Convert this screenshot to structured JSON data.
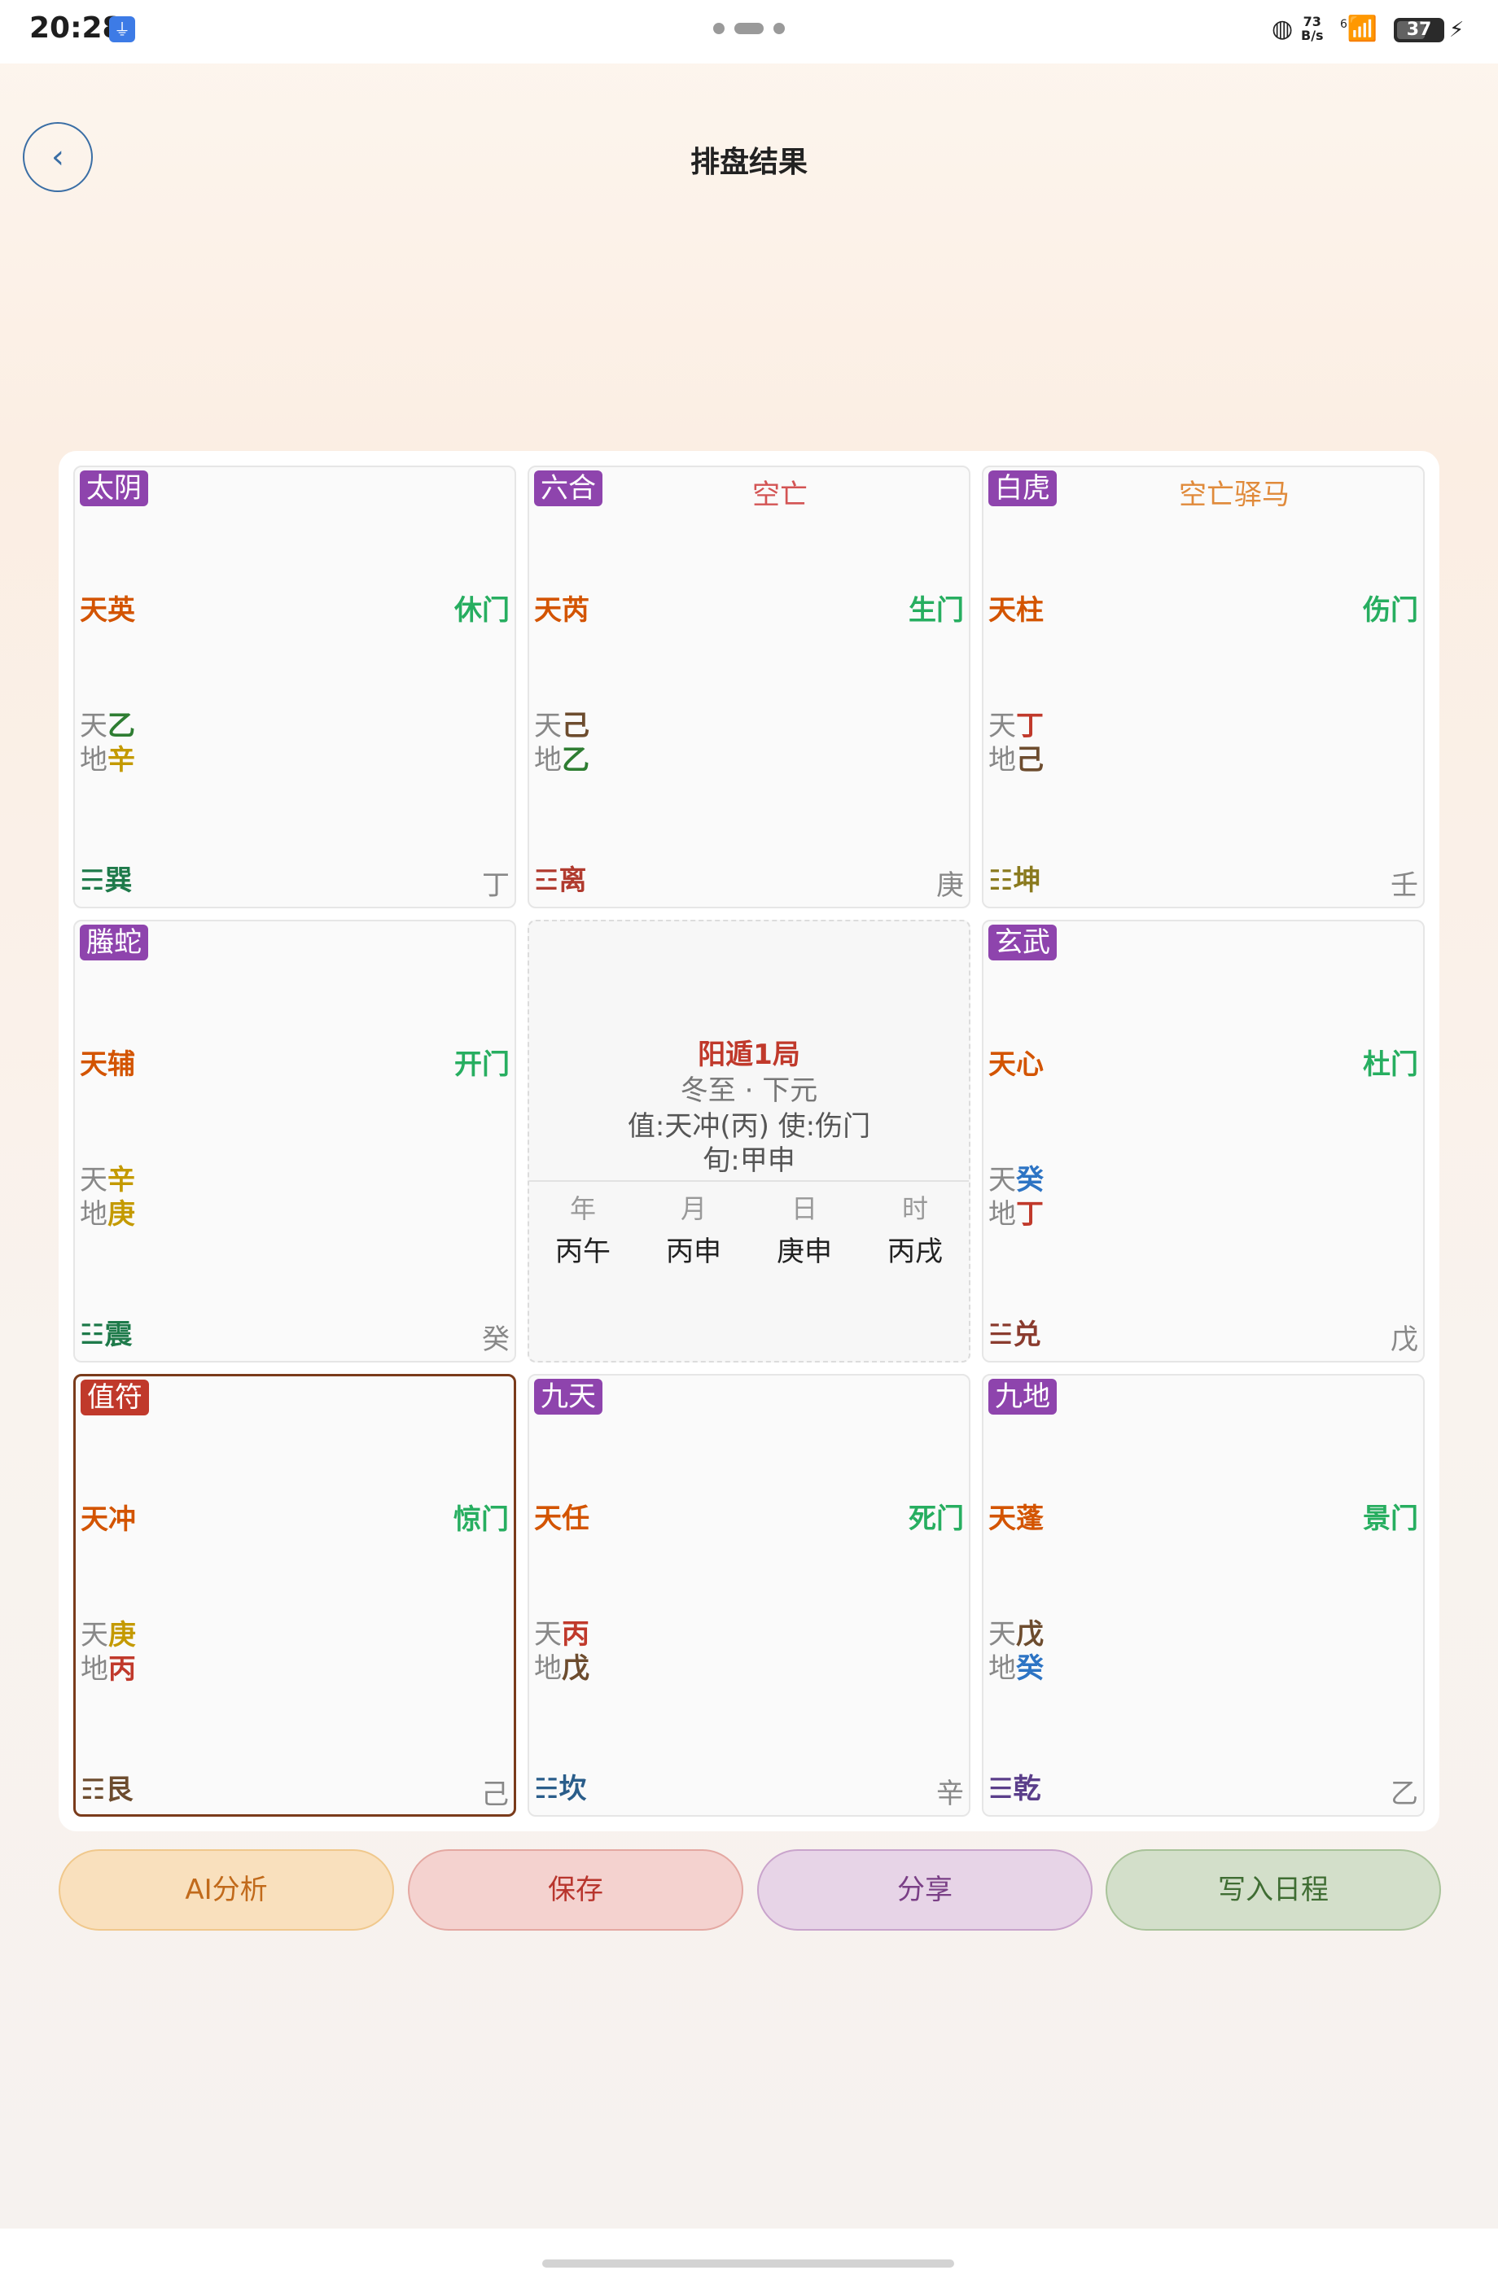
{
  "status_bar": {
    "time": "20:28",
    "net_speed_value": "73",
    "net_speed_unit": "B/s",
    "battery": "37",
    "wifi_badge": "6"
  },
  "header": {
    "title": "排盘结果",
    "back_label": "‹"
  },
  "colors": {
    "spirit_bg": "#8e44ad",
    "zhifu_bg": "#c0392b",
    "star": "#d35400",
    "door": "#27ae60",
    "empty_tag": "#d35454",
    "horse_tag": "#e08a3a",
    "fire": "#c0392b",
    "earth": "#6d4c2e",
    "wood": "#2e7d32",
    "metal": "#c49a00",
    "water": "#2d74c4"
  },
  "palaces": {
    "p4": {
      "spirit": "太阴",
      "tags": "",
      "star": "天英",
      "door": "休门",
      "heaven_label": "天",
      "heaven_stem": "乙",
      "earth_label": "地",
      "earth_stem": "辛",
      "trigram_symbol": "☴",
      "trigram": "巽",
      "hidden_stem": "丁"
    },
    "p9": {
      "spirit": "六合",
      "tags": "空亡",
      "star": "天芮",
      "door": "生门",
      "heaven_label": "天",
      "heaven_stem": "己",
      "earth_label": "地",
      "earth_stem": "乙",
      "trigram_symbol": "☲",
      "trigram": "离",
      "hidden_stem": "庚"
    },
    "p2": {
      "spirit": "白虎",
      "tags": "空亡驿马",
      "star": "天柱",
      "door": "伤门",
      "heaven_label": "天",
      "heaven_stem": "丁",
      "earth_label": "地",
      "earth_stem": "己",
      "trigram_symbol": "☷",
      "trigram": "坤",
      "hidden_stem": "壬"
    },
    "p3": {
      "spirit": "螣蛇",
      "tags": "",
      "star": "天辅",
      "door": "开门",
      "heaven_label": "天",
      "heaven_stem": "辛",
      "earth_label": "地",
      "earth_stem": "庚",
      "trigram_symbol": "☳",
      "trigram": "震",
      "hidden_stem": "癸"
    },
    "p7": {
      "spirit": "玄武",
      "tags": "",
      "star": "天心",
      "door": "杜门",
      "heaven_label": "天",
      "heaven_stem": "癸",
      "earth_label": "地",
      "earth_stem": "丁",
      "trigram_symbol": "☱",
      "trigram": "兑",
      "hidden_stem": "戊"
    },
    "p8": {
      "spirit": "值符",
      "tags": "",
      "star": "天冲",
      "door": "惊门",
      "heaven_label": "天",
      "heaven_stem": "庚",
      "earth_label": "地",
      "earth_stem": "丙",
      "trigram_symbol": "☶",
      "trigram": "艮",
      "hidden_stem": "己"
    },
    "p1": {
      "spirit": "九天",
      "tags": "",
      "star": "天任",
      "door": "死门",
      "heaven_label": "天",
      "heaven_stem": "丙",
      "earth_label": "地",
      "earth_stem": "戊",
      "trigram_symbol": "☵",
      "trigram": "坎",
      "hidden_stem": "辛"
    },
    "p6": {
      "spirit": "九地",
      "tags": "",
      "star": "天蓬",
      "door": "景门",
      "heaven_label": "天",
      "heaven_stem": "戊",
      "earth_label": "地",
      "earth_stem": "癸",
      "trigram_symbol": "☰",
      "trigram": "乾",
      "hidden_stem": "乙"
    }
  },
  "center": {
    "ju": "阳遁1局",
    "jieqi": "冬至 · 下元",
    "zhishi": "值:天冲(丙) 使:伤门",
    "xun": "旬:甲申",
    "pillars": [
      {
        "label": "年",
        "value": "丙午"
      },
      {
        "label": "月",
        "value": "丙申"
      },
      {
        "label": "日",
        "value": "庚申"
      },
      {
        "label": "时",
        "value": "丙戌"
      }
    ]
  },
  "actions": {
    "ai": "AI分析",
    "save": "保存",
    "share": "分享",
    "calendar": "写入日程"
  }
}
